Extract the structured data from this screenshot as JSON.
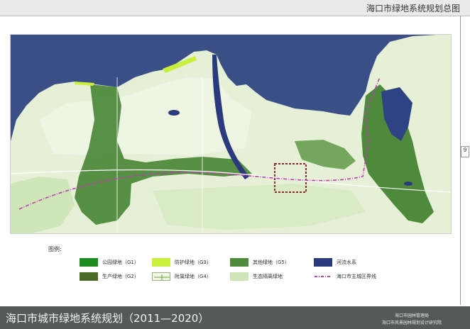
{
  "header": {
    "title": "海口市绿地系统规划总图"
  },
  "page_number": "9",
  "legend": {
    "title": "图例:",
    "items": [
      {
        "label": "公园绿地（G1）",
        "color": "#1e8c1e",
        "kind": "fill"
      },
      {
        "label": "防护绿地（G3）",
        "color": "#c8f03c",
        "kind": "fill"
      },
      {
        "label": "其他绿地（G5）",
        "color": "#4d8a3a",
        "kind": "fill"
      },
      {
        "label": "河流水系",
        "color": "#2a3a7c",
        "kind": "fill"
      },
      {
        "label": "生产绿地（G2）",
        "color": "#4a6a2a",
        "kind": "fill"
      },
      {
        "label": "附属绿地（G4）",
        "color": "#f4f8e8",
        "kind": "attached"
      },
      {
        "label": "生态隔离绿地",
        "color": "#cfe6b8",
        "kind": "fill"
      },
      {
        "label": "海口市主城区界线",
        "color": "#c03cb4",
        "kind": "boundary"
      }
    ]
  },
  "footer": {
    "title": "海口市城市绿地系统规划（2011—2020）",
    "org_line1": "海口市园林管理局",
    "org_line2": "海口市风景园林规划设计研究院"
  },
  "colors": {
    "sea": "#3a4f86",
    "land": "#e6f0d6",
    "green": "#4f8a3c",
    "water": "#2a3a7c",
    "boundary": "#c03cb4",
    "road": "#ffffff"
  }
}
